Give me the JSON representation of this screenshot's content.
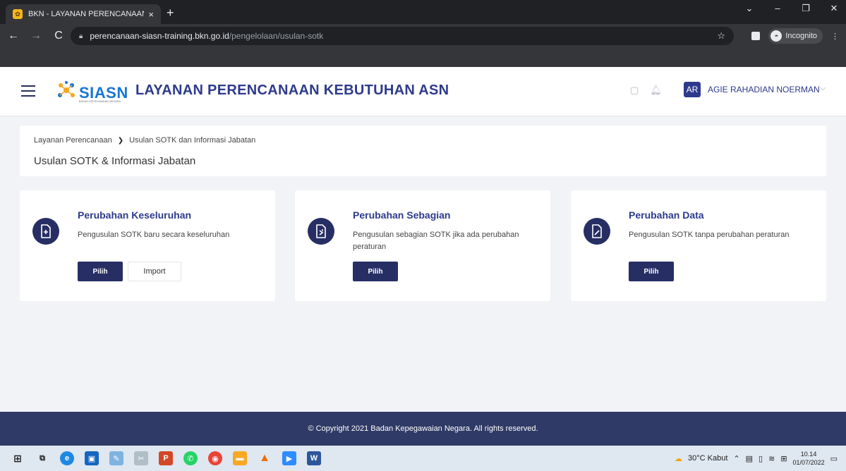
{
  "browser": {
    "tab_title": "BKN - LAYANAN PERENCANAAN",
    "tab_close": "×",
    "new_tab": "+",
    "url_host": "perencanaan-siasn-training.bkn.go.id",
    "url_path": "/pengelolaan/usulan-sotk",
    "incognito_label": "Incognito",
    "win_controls": [
      "⌄",
      "–",
      "❐",
      "✕"
    ]
  },
  "header": {
    "logo_text": "SIASN",
    "logo_subtext": "BADAN KEPEGAWAIAN NEGARA",
    "app_title": "LAYANAN PERENCANAAN KEBUTUHAN ASN",
    "user_initials": "AR",
    "user_name": "AGIE RAHADIAN NOERMAN"
  },
  "breadcrumb": {
    "items": [
      "Layanan Perencanaan",
      "Usulan SOTK dan Informasi Jabatan"
    ],
    "separator": "❯"
  },
  "page_title": "Usulan SOTK & Informasi Jabatan",
  "cards": [
    {
      "title": "Perubahan Keseluruhan",
      "description": "Pengusulan SOTK baru secara keseluruhan",
      "primary_button": "Pilih",
      "secondary_button": "Import",
      "icon": "file-plus-icon"
    },
    {
      "title": "Perubahan Sebagian",
      "description": "Pengusulan sebagian SOTK jika ada perubahan peraturan",
      "primary_button": "Pilih",
      "icon": "file-edit-partial-icon"
    },
    {
      "title": "Perubahan Data",
      "description": "Pengusulan SOTK tanpa perubahan peraturan",
      "primary_button": "Pilih",
      "icon": "file-pencil-icon"
    }
  ],
  "footer": {
    "copyright": "© Copyright 2021 Badan Kepegawaian Negara. All rights reserved."
  },
  "taskbar": {
    "weather": "30°C Kabut",
    "time": "10.14",
    "date": "01/07/2022"
  },
  "colors": {
    "brand_navy": "#262e64",
    "title_blue": "#2d3a8c",
    "footer_bg": "#2f3a66"
  }
}
